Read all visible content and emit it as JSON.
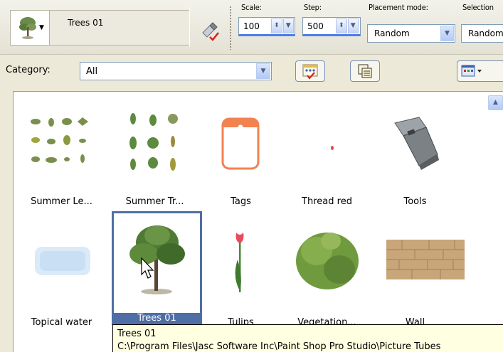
{
  "toolbar": {
    "tube_name": "Trees 01",
    "scale_label": "Scale:",
    "scale_value": "100",
    "step_label": "Step:",
    "step_value": "500",
    "placement_label": "Placement mode:",
    "placement_value": "Random",
    "selection_label": "Selection",
    "selection_value": "Random"
  },
  "category": {
    "label": "Category:",
    "value": "All"
  },
  "gallery": {
    "items": [
      {
        "name": "Summer Le...",
        "icon": "leaves-thumbnail"
      },
      {
        "name": "Summer Tr...",
        "icon": "trees-thumbnail"
      },
      {
        "name": "Tags",
        "icon": "tag-thumbnail"
      },
      {
        "name": "Thread red",
        "icon": "thread-thumbnail"
      },
      {
        "name": "Tools",
        "icon": "stapler-thumbnail"
      },
      {
        "name": "Topical water",
        "icon": "water-thumbnail"
      },
      {
        "name": "Trees 01",
        "icon": "tree-thumbnail",
        "selected": true
      },
      {
        "name": "Tulips",
        "icon": "tulip-thumbnail"
      },
      {
        "name": "Vegetation...",
        "icon": "bush-thumbnail"
      },
      {
        "name": "Wall",
        "icon": "wall-thumbnail"
      }
    ]
  },
  "tooltip": {
    "title": "Trees 01",
    "path": "C:\\Program Files\\Jasc Software Inc\\Paint Shop Pro Studio\\Picture Tubes"
  },
  "colors": {
    "selection": "#4f6ea5",
    "toolbar_bg": "#ece9d8",
    "tooltip_bg": "#ffffe1"
  }
}
